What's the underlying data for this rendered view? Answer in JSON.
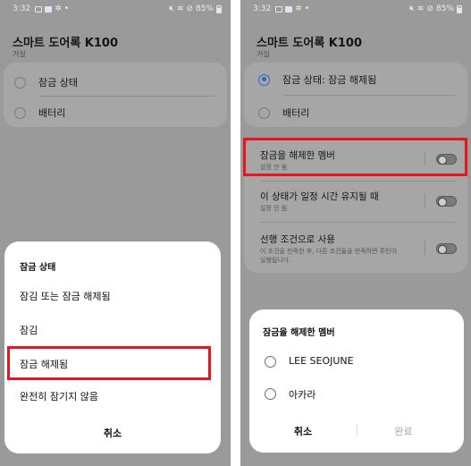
{
  "status_bar": {
    "time": "3:32",
    "battery": "85%"
  },
  "left_screen": {
    "title": "스마트 도어록 K100",
    "subtitle": "거실",
    "options": [
      {
        "label": "잠금 상태"
      },
      {
        "label": "배터리"
      }
    ],
    "sheet": {
      "title": "잠금 상태",
      "options": [
        {
          "label": "잠김 또는 잠금 해제됨"
        },
        {
          "label": "잠김"
        },
        {
          "label": "잠금 해제됨",
          "highlighted": true
        },
        {
          "label": "완전히 잠기지 않음"
        }
      ],
      "cancel_label": "취소"
    }
  },
  "right_screen": {
    "title": "스마트 도어록 K100",
    "subtitle": "거실",
    "options": [
      {
        "label": "잠금 상태: 잠금 해제됨",
        "selected": true
      },
      {
        "label": "배터리",
        "selected": false
      }
    ],
    "conditions": [
      {
        "title": "잠금을 해제한 멤버",
        "subtitle": "설정 안 됨",
        "enabled": false,
        "highlighted": true
      },
      {
        "title": "이 상태가 일정 시간 유지될 때",
        "subtitle": "설정 안 됨",
        "enabled": false
      },
      {
        "title": "선행 조건으로 사용",
        "subtitle_line1": "이 조건을 만족한 후, 다른 조건들을 만족하면 루틴이",
        "subtitle_line2": "실행됩니다.",
        "enabled": false
      }
    ],
    "sheet": {
      "title": "잠금을 해제한 멤버",
      "members": [
        {
          "label": "LEE SEOJUNE"
        },
        {
          "label": "아카라"
        }
      ],
      "cancel_label": "취소",
      "done_label": "완료"
    }
  },
  "colors": {
    "highlight": "#e8141e",
    "accent": "#2f64c8",
    "dim_background": "#9a9a9a"
  }
}
